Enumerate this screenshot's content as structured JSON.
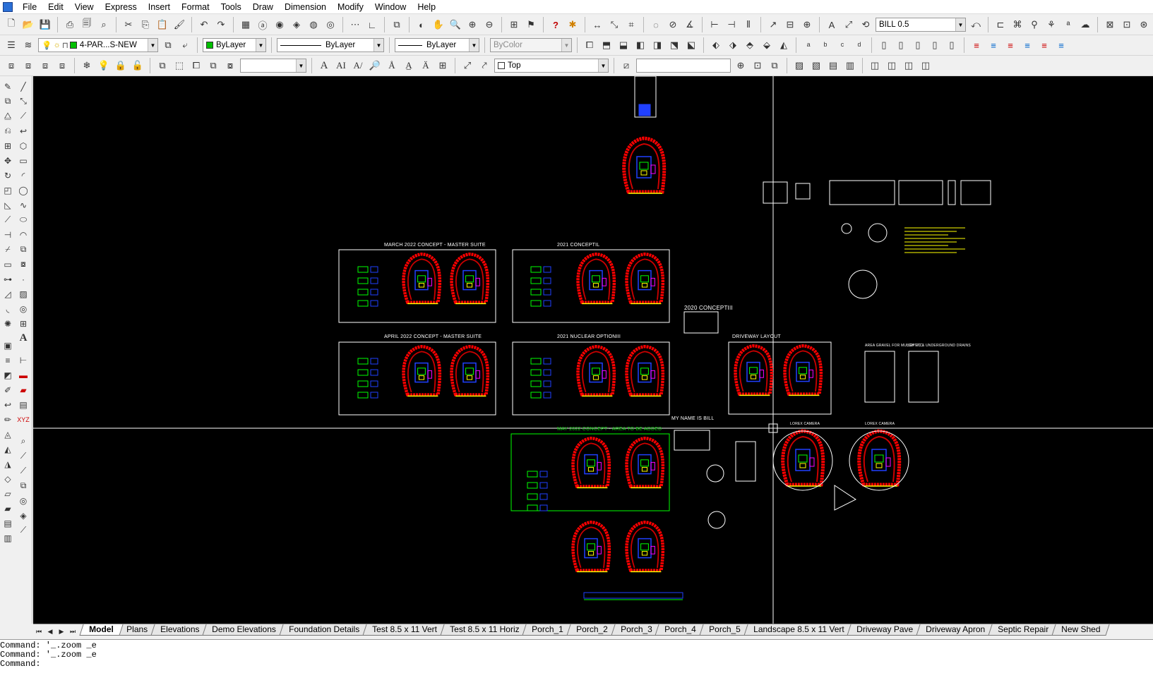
{
  "menu": [
    "File",
    "Edit",
    "View",
    "Express",
    "Insert",
    "Format",
    "Tools",
    "Draw",
    "Dimension",
    "Modify",
    "Window",
    "Help"
  ],
  "toolbar": {
    "dimstyle_combo": "BILL 0.5",
    "layer_combo": "4-PAR...S-NEW",
    "color_combo": "ByLayer",
    "linetype_combo": "ByLayer",
    "lineweight_combo": "ByLayer",
    "plotstyle_combo": "ByColor",
    "textstyle_combo": "",
    "view_combo": "Top",
    "ucs_combo": ""
  },
  "drawing": {
    "labels": {
      "march": "MARCH 2022 CONCEPT - MASTER SUITE",
      "c2021": "2021 CONCEPTIL",
      "april": "APRIL 2022 CONCEPT - MASTER SUITE",
      "nuclear": "2021 NUCLEAR OPTIONIII",
      "c2020": "2020 CONCEPTIII",
      "driveway": "DRIVEWAY LAYOUT",
      "name": "MY NAME IS BILL",
      "may": "MAY 2022 CONCEPT - AREA TO BE ADDED",
      "area_gravel": "AREA GRAVEL FOR MULCH ETC",
      "septic": "SEPTIC & UNDERGROUND DRAINS",
      "lorex1": "LOREX CAMERA",
      "lorex2": "LOREX CAMERA"
    }
  },
  "tabs": [
    "Model",
    "Plans",
    "Elevations",
    "Demo Elevations",
    "Foundation Details",
    "Test 8.5 x 11 Vert",
    "Test 8.5 x 11 Horiz",
    "Porch_1",
    "Porch_2",
    "Porch_3",
    "Porch_4",
    "Porch_5",
    "Landscape 8.5 x 11 Vert",
    "Driveway Pave",
    "Driveway Apron",
    "Septic Repair",
    "New Shed"
  ],
  "command_lines": [
    "Command: '_.zoom _e",
    "Command: '_.zoom _e",
    "Command:"
  ]
}
